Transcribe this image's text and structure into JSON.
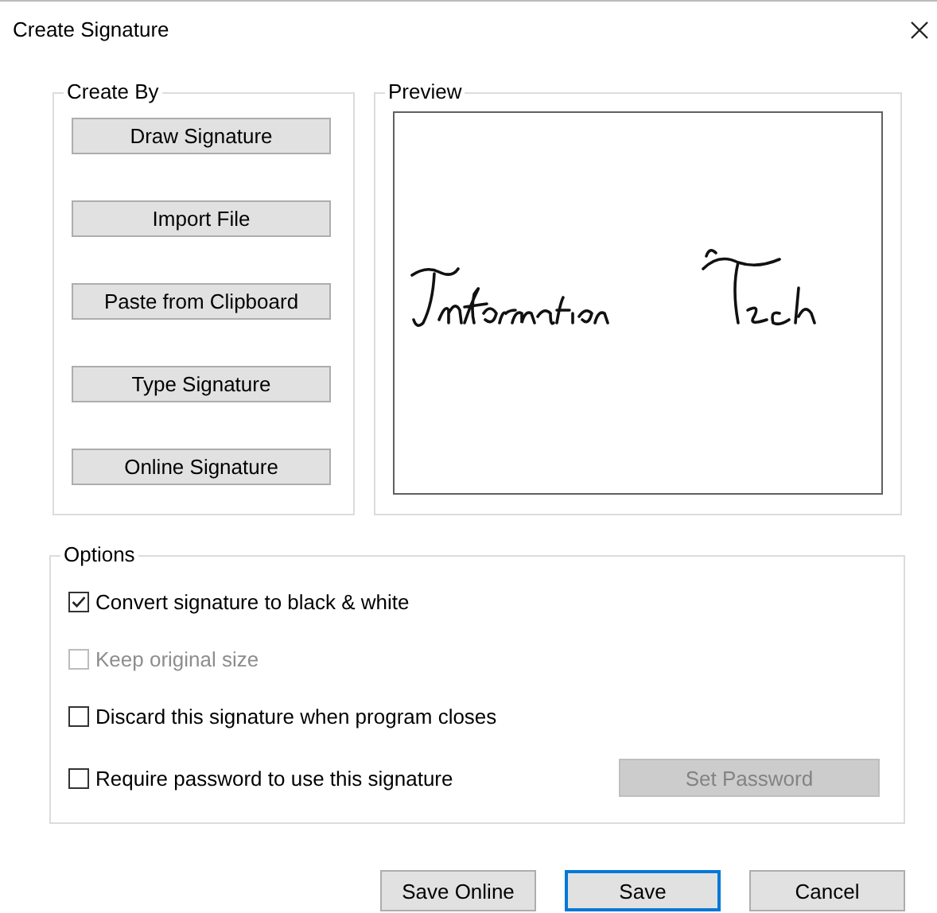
{
  "window": {
    "title": "Create Signature"
  },
  "create_by": {
    "title": "Create By",
    "buttons": [
      "Draw Signature",
      "Import File",
      "Paste from Clipboard",
      "Type Signature",
      "Online Signature"
    ]
  },
  "preview": {
    "title": "Preview"
  },
  "options": {
    "title": "Options",
    "checkboxes": [
      {
        "label": "Convert signature to black & white",
        "checked": true,
        "disabled": false
      },
      {
        "label": "Keep original size",
        "checked": false,
        "disabled": true
      },
      {
        "label": "Discard this signature when program closes",
        "checked": false,
        "disabled": false
      },
      {
        "label": "Require password to use this signature",
        "checked": false,
        "disabled": false
      }
    ],
    "set_password": {
      "label": "Set Password",
      "disabled": true
    }
  },
  "buttons": [
    {
      "label": "Save Online",
      "default": false
    },
    {
      "label": "Save",
      "default": true
    },
    {
      "label": "Cancel",
      "default": false
    }
  ]
}
